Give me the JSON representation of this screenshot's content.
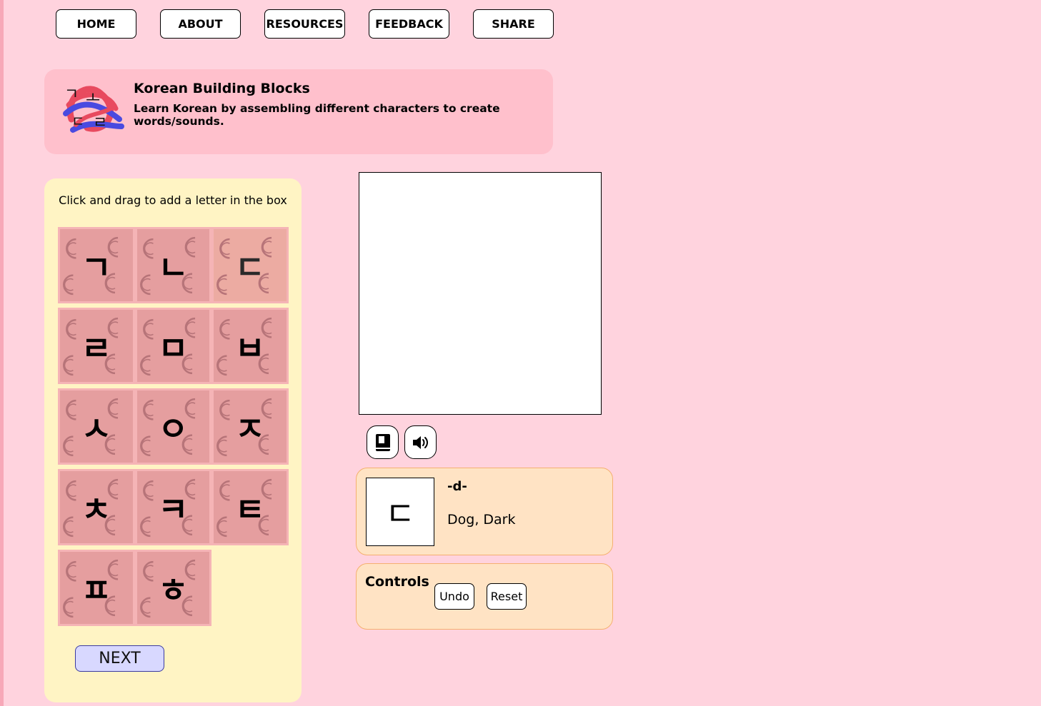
{
  "nav": {
    "items": [
      {
        "label": "HOME"
      },
      {
        "label": "ABOUT"
      },
      {
        "label": "RESOURCES"
      },
      {
        "label": "FEEDBACK"
      },
      {
        "label": "SHARE"
      }
    ]
  },
  "header": {
    "logo_icon": "hangul-logo-icon",
    "title": "Korean Building Blocks",
    "subtitle": "Learn Korean by assembling different characters to create words/sounds."
  },
  "letters": {
    "hint": "Click and drag to add a letter in the box",
    "tiles": [
      {
        "char": "ㄱ"
      },
      {
        "char": "ㄴ"
      },
      {
        "char": "ㄷ"
      },
      {
        "char": "ㄹ"
      },
      {
        "char": "ㅁ"
      },
      {
        "char": "ㅂ"
      },
      {
        "char": "ㅅ"
      },
      {
        "char": "ㅇ"
      },
      {
        "char": "ㅈ"
      },
      {
        "char": "ㅊ"
      },
      {
        "char": "ㅋ"
      },
      {
        "char": "ㅌ"
      },
      {
        "char": "ㅍ"
      },
      {
        "char": "ㅎ"
      }
    ],
    "next_label": "NEXT"
  },
  "workspace": {
    "buttons": [
      {
        "icon": "book-icon"
      },
      {
        "icon": "speaker-icon"
      }
    ]
  },
  "info": {
    "character": "ㄷ",
    "romanization": "-d-",
    "examples": "Dog, Dark"
  },
  "controls": {
    "title": "Controls",
    "undo_label": "Undo",
    "reset_label": "Reset"
  },
  "colors": {
    "background": "#ffd3de",
    "banner": "#ffc0cc",
    "panel": "#fff4c4",
    "tile": "#e59e9f",
    "card": "#ffe3c4",
    "next_button": "#d8d8ff"
  }
}
